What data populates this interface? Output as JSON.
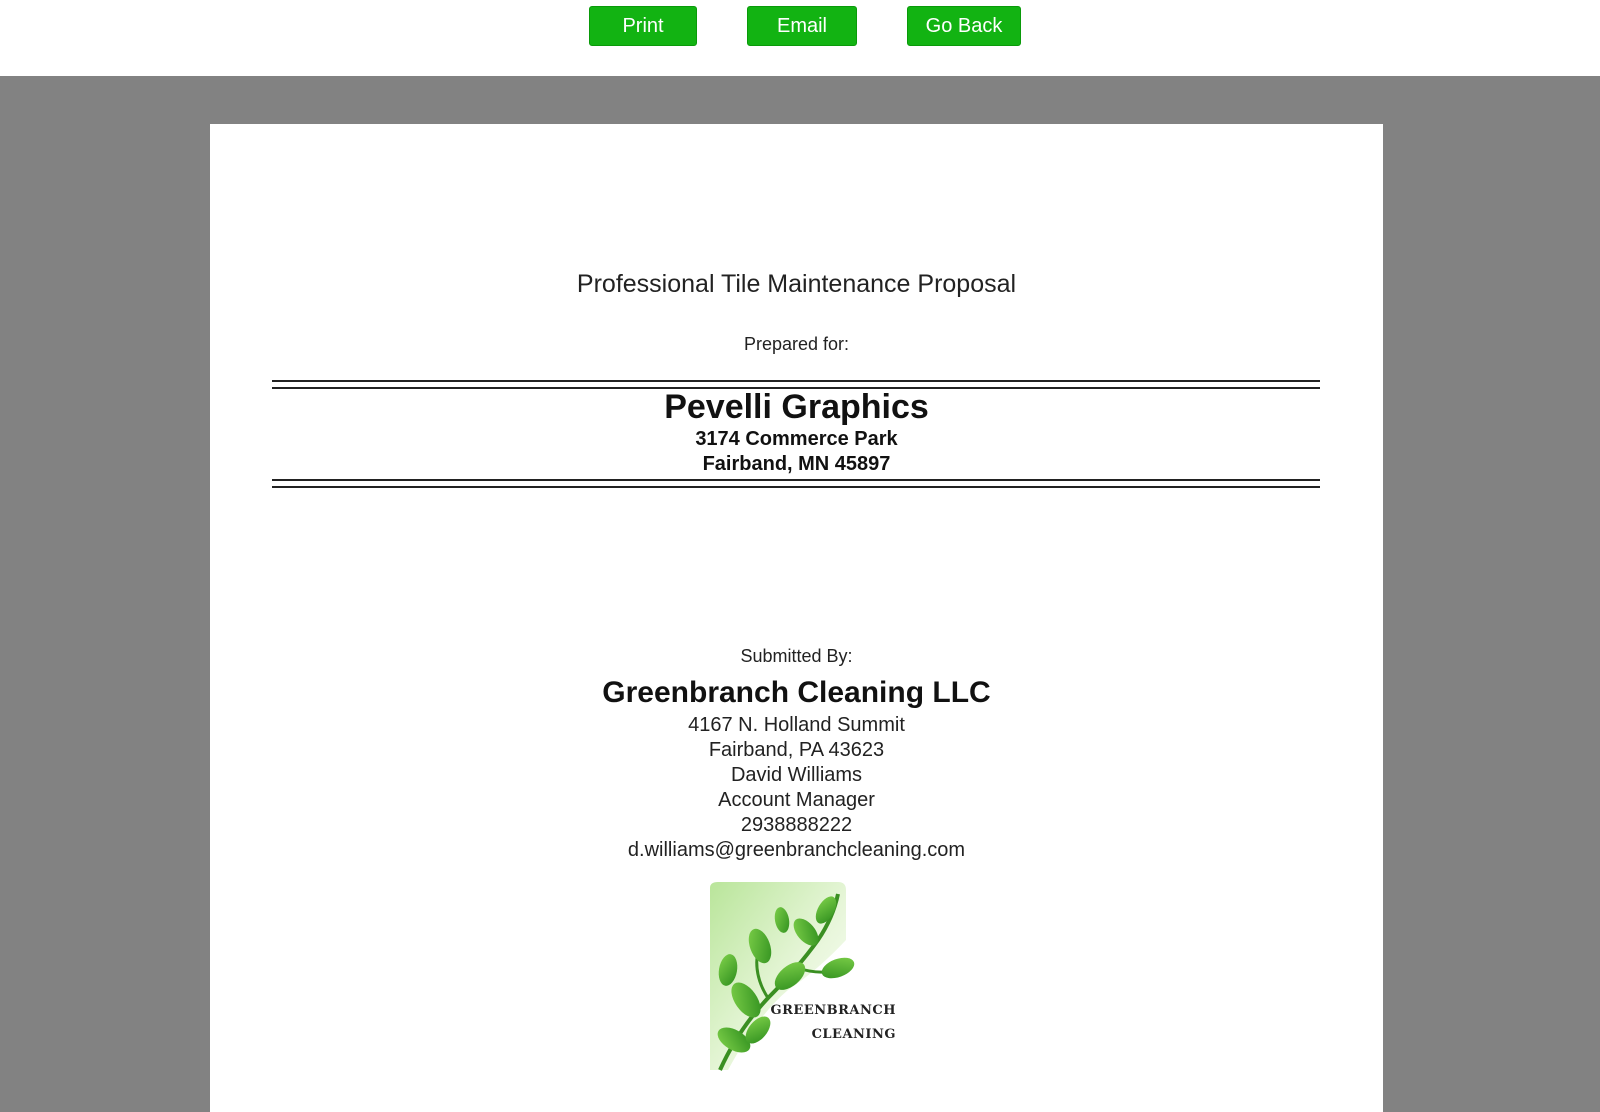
{
  "toolbar": {
    "print_label": "Print",
    "email_label": "Email",
    "back_label": "Go Back",
    "button_color": "#12b312"
  },
  "document": {
    "title": "Professional Tile Maintenance Proposal",
    "prepared_for_label": "Prepared for:",
    "client": {
      "name": "Pevelli Graphics",
      "address_line1": "3174 Commerce Park",
      "address_line2": "Fairband, MN 45897"
    },
    "submitted_by_label": "Submitted By:",
    "company": {
      "name": "Greenbranch Cleaning LLC",
      "address_line1": "4167 N. Holland Summit",
      "address_line2": "Fairband, PA 43623",
      "contact_name": "David Williams",
      "contact_title": "Account Manager",
      "phone": "2938888222",
      "email": "d.williams@greenbranchcleaning.com"
    },
    "logo": {
      "line1": "Greenbranch",
      "line2": "Cleaning",
      "icon": "leaf-branch-icon",
      "accent_color": "#4caf2a"
    }
  },
  "viewer": {
    "background_color": "#828282"
  }
}
